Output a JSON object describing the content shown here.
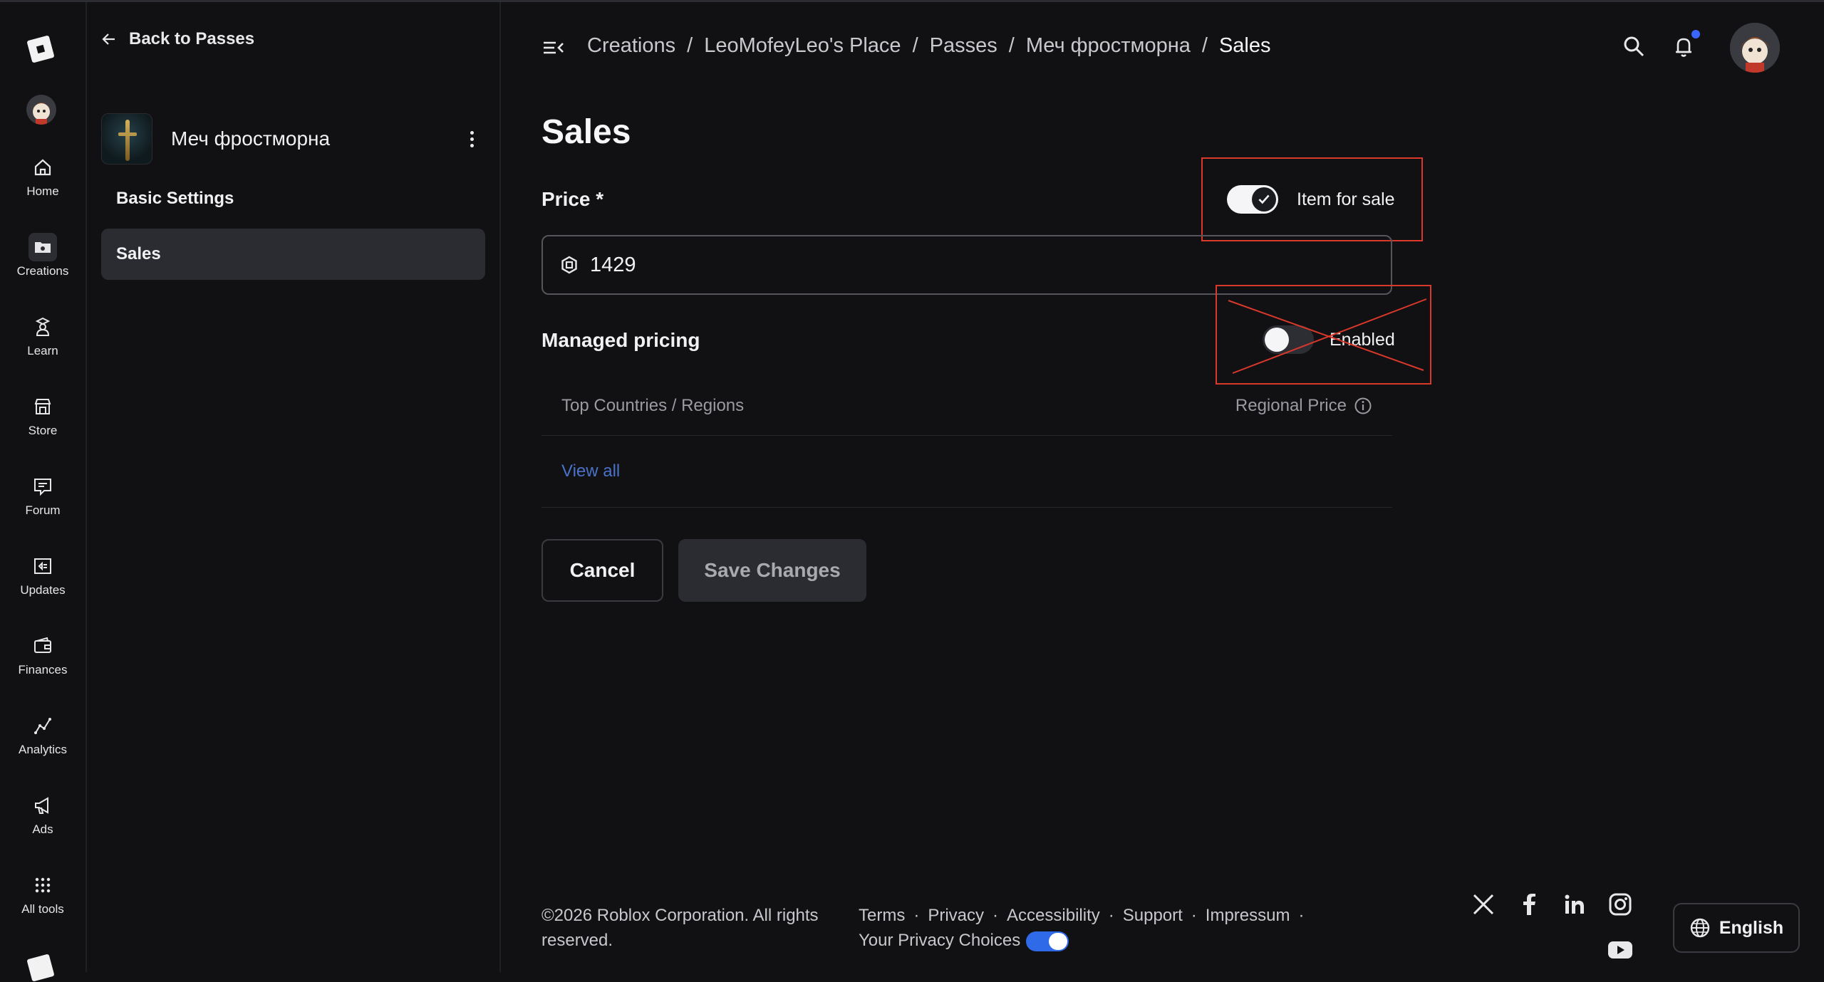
{
  "rail": {
    "items": [
      {
        "label": "Home",
        "icon": "home-icon"
      },
      {
        "label": "Creations",
        "icon": "folder-icon"
      },
      {
        "label": "Learn",
        "icon": "graduation-icon"
      },
      {
        "label": "Store",
        "icon": "store-icon"
      },
      {
        "label": "Forum",
        "icon": "chat-icon"
      },
      {
        "label": "Updates",
        "icon": "updates-icon"
      },
      {
        "label": "Finances",
        "icon": "wallet-icon"
      },
      {
        "label": "Analytics",
        "icon": "analytics-icon"
      },
      {
        "label": "Ads",
        "icon": "megaphone-icon"
      },
      {
        "label": "All tools",
        "icon": "grid-icon"
      }
    ],
    "active": "Creations"
  },
  "sidebar": {
    "back_label": "Back to Passes",
    "item_name": "Меч фростморна",
    "nav": [
      {
        "label": "Basic Settings"
      },
      {
        "label": "Sales"
      }
    ],
    "active": "Sales"
  },
  "header": {
    "breadcrumb": [
      "Creations",
      "LeoMofeyLeo's Place",
      "Passes",
      "Меч фростморна",
      "Sales"
    ],
    "separator": "/",
    "notification_dot": true
  },
  "main": {
    "title": "Sales",
    "price_label": "Price *",
    "price_value": "1429",
    "item_for_sale_label": "Item for sale",
    "item_for_sale_on": true,
    "managed_pricing_label": "Managed pricing",
    "managed_pricing_state": "Enabled",
    "managed_pricing_on": false,
    "table": {
      "col_country": "Top Countries / Regions",
      "col_regional": "Regional Price"
    },
    "view_all": "View all",
    "cancel_label": "Cancel",
    "save_label": "Save Changes"
  },
  "footer": {
    "copyright": "©2026 Roblox Corporation. All rights reserved.",
    "links": [
      "Terms",
      "Privacy",
      "Accessibility",
      "Support",
      "Impressum"
    ],
    "privacy_choices": "Your Privacy Choices",
    "language": "English",
    "social": [
      "x-icon",
      "facebook-icon",
      "linkedin-icon",
      "instagram-icon",
      "youtube-icon"
    ]
  },
  "colors": {
    "background": "#111114",
    "accent_blue": "#3a66ff",
    "link_blue": "#4a72c8",
    "annotation_red": "#d9382b"
  }
}
